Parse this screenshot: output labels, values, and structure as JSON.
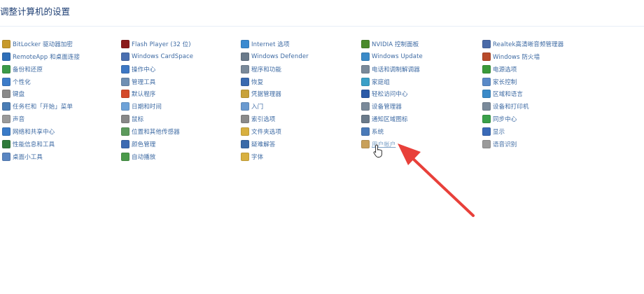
{
  "page_title": "调整计算机的设置",
  "columns": [
    {
      "items": [
        {
          "label": "BitLocker 驱动器加密",
          "icon": "bitlocker-icon",
          "color": "#c79a2c"
        },
        {
          "label": "RemoteApp 和桌面连接",
          "icon": "remoteapp-icon",
          "color": "#2f6fb8"
        },
        {
          "label": "备份和还原",
          "icon": "backup-icon",
          "color": "#3b9a48"
        },
        {
          "label": "个性化",
          "icon": "personalization-icon",
          "color": "#3d7cc9"
        },
        {
          "label": "键盘",
          "icon": "keyboard-icon",
          "color": "#8a8a8a"
        },
        {
          "label": "任务栏和「开始」菜单",
          "icon": "taskbar-icon",
          "color": "#4a7db5"
        },
        {
          "label": "声音",
          "icon": "sound-icon",
          "color": "#9a9a9a"
        },
        {
          "label": "网络和共享中心",
          "icon": "network-icon",
          "color": "#3a7bc8"
        },
        {
          "label": "性能信息和工具",
          "icon": "performance-icon",
          "color": "#2f7a3a"
        },
        {
          "label": "桌面小工具",
          "icon": "gadgets-icon",
          "color": "#5a86c2"
        }
      ]
    },
    {
      "items": [
        {
          "label": "Flash Player (32 位)",
          "icon": "flash-icon",
          "color": "#8b1a1a"
        },
        {
          "label": "Windows CardSpace",
          "icon": "cardspace-icon",
          "color": "#4a6fb0"
        },
        {
          "label": "操作中心",
          "icon": "action-center-icon",
          "color": "#3e78c4"
        },
        {
          "label": "管理工具",
          "icon": "admin-tools-icon",
          "color": "#6f8fb3"
        },
        {
          "label": "默认程序",
          "icon": "default-programs-icon",
          "color": "#d44a2a"
        },
        {
          "label": "日期和时间",
          "icon": "clock-icon",
          "color": "#6ea2d8"
        },
        {
          "label": "鼠标",
          "icon": "mouse-icon",
          "color": "#888888"
        },
        {
          "label": "位置和其他传感器",
          "icon": "sensor-icon",
          "color": "#5c9a5c"
        },
        {
          "label": "颜色管理",
          "icon": "color-management-icon",
          "color": "#3c6ab2"
        },
        {
          "label": "自动播放",
          "icon": "autoplay-icon",
          "color": "#4a9a4a"
        }
      ]
    },
    {
      "items": [
        {
          "label": "Internet 选项",
          "icon": "internet-icon",
          "color": "#3a8ad0"
        },
        {
          "label": "Windows Defender",
          "icon": "defender-icon",
          "color": "#6a7a8a"
        },
        {
          "label": "程序和功能",
          "icon": "programs-icon",
          "color": "#7a8a9a"
        },
        {
          "label": "恢复",
          "icon": "recovery-icon",
          "color": "#3a6ab0"
        },
        {
          "label": "凭据管理器",
          "icon": "credential-icon",
          "color": "#c8a23a"
        },
        {
          "label": "入门",
          "icon": "getting-started-icon",
          "color": "#6a9ad0"
        },
        {
          "label": "索引选项",
          "icon": "indexing-icon",
          "color": "#8a8a8a"
        },
        {
          "label": "文件夹选项",
          "icon": "folder-icon",
          "color": "#d8b040"
        },
        {
          "label": "疑难解答",
          "icon": "troubleshoot-icon",
          "color": "#3a6aa8"
        },
        {
          "label": "字体",
          "icon": "fonts-icon",
          "color": "#d8b040"
        }
      ]
    },
    {
      "items": [
        {
          "label": "NVIDIA 控制面板",
          "icon": "nvidia-icon",
          "color": "#4a8a2a"
        },
        {
          "label": "Windows Update",
          "icon": "windows-update-icon",
          "color": "#3a8ac8"
        },
        {
          "label": "电话和调制解调器",
          "icon": "phone-icon",
          "color": "#7a8a9a"
        },
        {
          "label": "家庭组",
          "icon": "homegroup-icon",
          "color": "#3aa0c8"
        },
        {
          "label": "轻松访问中心",
          "icon": "ease-of-access-icon",
          "color": "#2a5aa8"
        },
        {
          "label": "设备管理器",
          "icon": "device-manager-icon",
          "color": "#7a8a9a"
        },
        {
          "label": "通知区域图标",
          "icon": "notification-icon",
          "color": "#6a7a8a"
        },
        {
          "label": "系统",
          "icon": "system-icon",
          "color": "#4a7ab8"
        },
        {
          "label": "用户帐户",
          "icon": "user-accounts-icon",
          "color": "#c8a05a"
        }
      ]
    },
    {
      "items": [
        {
          "label": "Realtek高清晰音频管理器",
          "icon": "realtek-icon",
          "color": "#4a6aa8"
        },
        {
          "label": "Windows 防火墙",
          "icon": "firewall-icon",
          "color": "#b84a2a"
        },
        {
          "label": "电源选项",
          "icon": "power-icon",
          "color": "#3a9a3a"
        },
        {
          "label": "家长控制",
          "icon": "parental-icon",
          "color": "#5a8ac8"
        },
        {
          "label": "区域和语言",
          "icon": "region-icon",
          "color": "#3a8ac8"
        },
        {
          "label": "设备和打印机",
          "icon": "printer-icon",
          "color": "#7a8a9a"
        },
        {
          "label": "同步中心",
          "icon": "sync-icon",
          "color": "#3aa04a"
        },
        {
          "label": "显示",
          "icon": "display-icon",
          "color": "#3a6ab8"
        },
        {
          "label": "语音识别",
          "icon": "microphone-icon",
          "color": "#9a9a9a"
        }
      ]
    }
  ],
  "hovered_item": "用户帐户",
  "annotation_color": "#e8403a"
}
